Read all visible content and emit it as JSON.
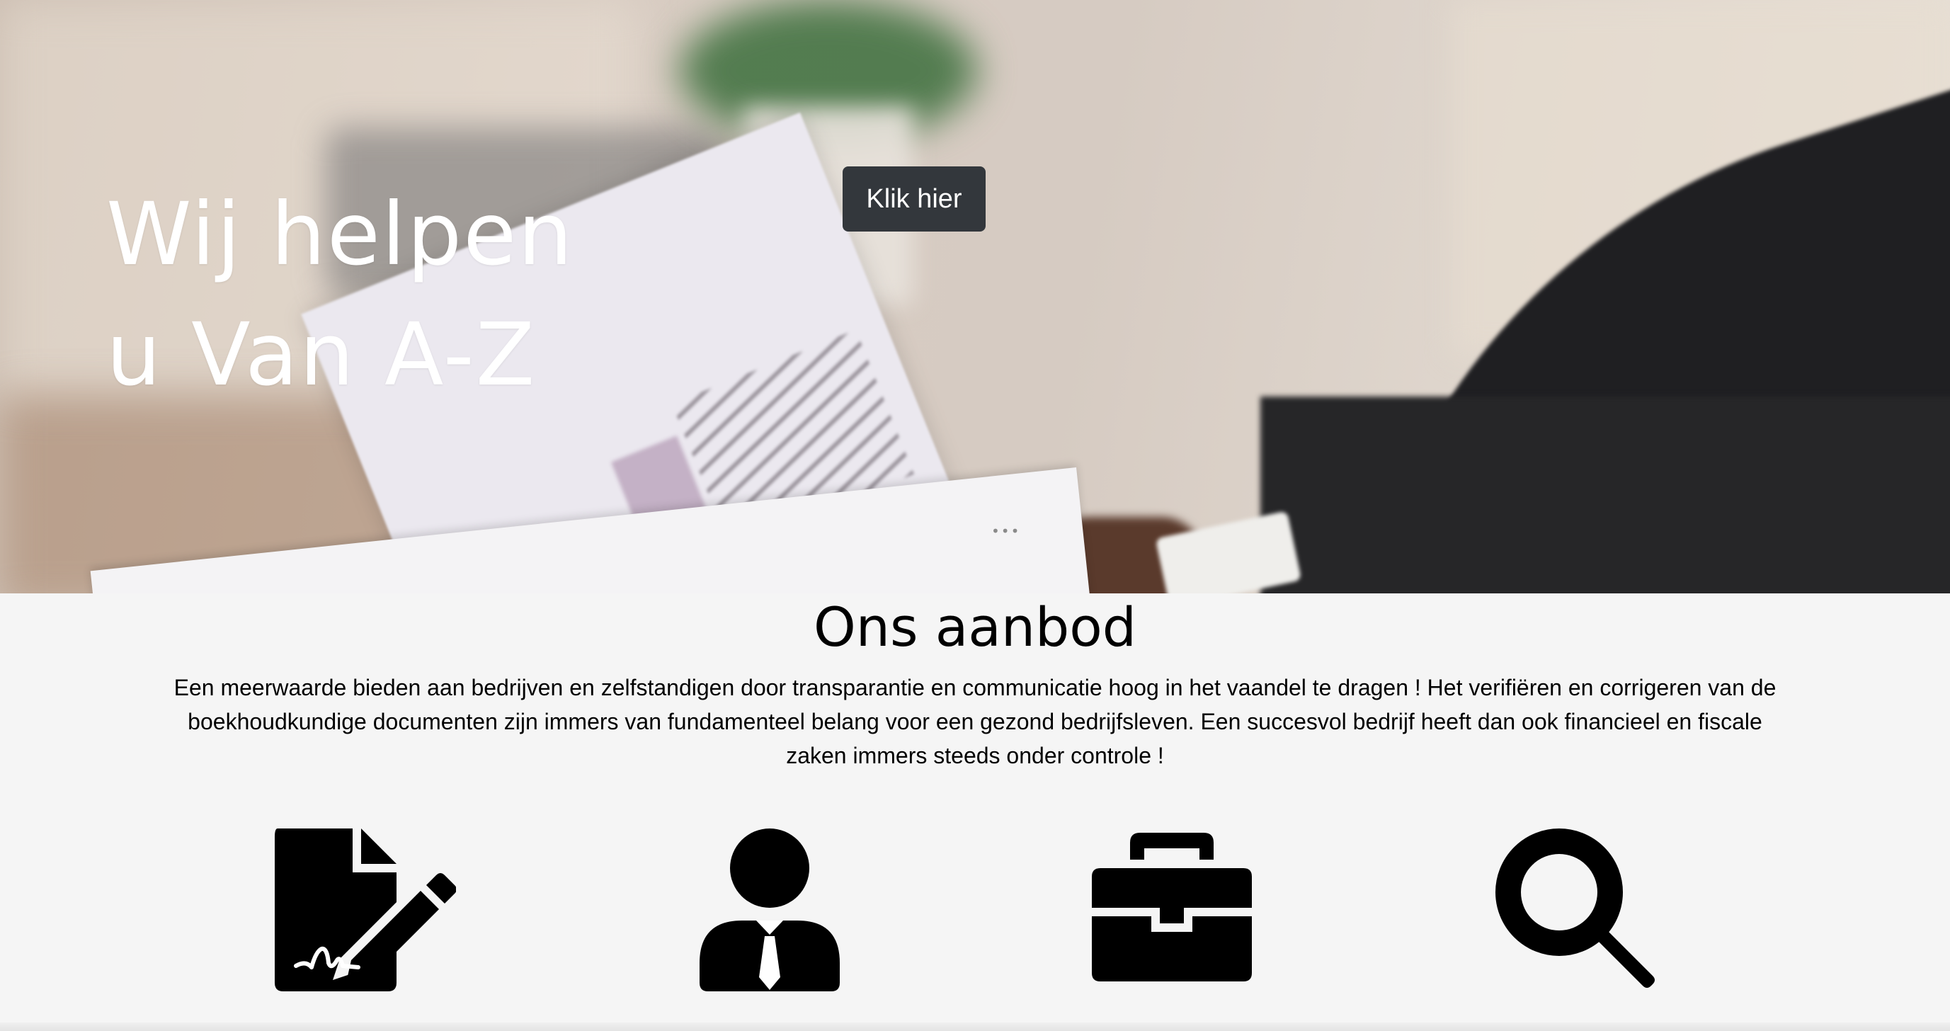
{
  "hero": {
    "title_line1": "Wij helpen",
    "title_line2": "u Van A-Z",
    "button_label": "Klik hier"
  },
  "aanbod": {
    "title": "Ons aanbod",
    "description": "Een meerwaarde bieden aan bedrijven en zelfstandigen door transparantie en communicatie hoog in het vaandel te dragen ! Het verifiëren en corrigeren van de boekhoudkundige documenten zijn immers van fundamenteel belang voor een gezond bedrijfsleven. Een succesvol bedrijf heeft dan ook financieel en fiscale zaken immers steeds onder controle !",
    "services": [
      {
        "icon": "file-signature-icon"
      },
      {
        "icon": "user-tie-icon"
      },
      {
        "icon": "briefcase-icon"
      },
      {
        "icon": "search-icon"
      }
    ]
  },
  "colors": {
    "button_bg": "#33373c",
    "button_text": "#ffffff",
    "section_bg": "#f5f5f5",
    "icon_color": "#000000"
  }
}
